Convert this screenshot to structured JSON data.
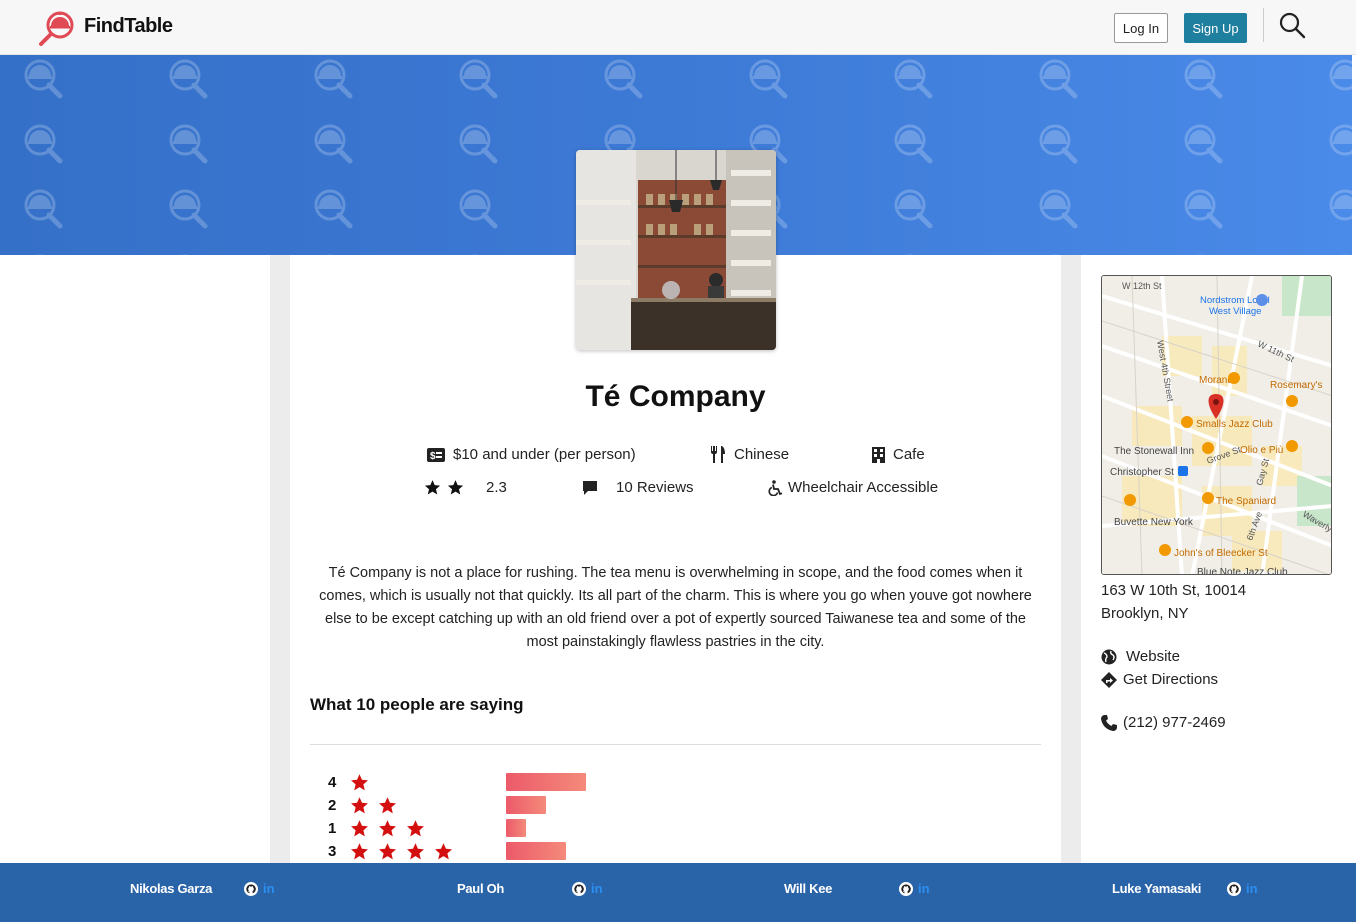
{
  "header": {
    "brand": "FindTable",
    "login_label": "Log In",
    "signup_label": "Sign Up",
    "search_icon": "search-icon"
  },
  "restaurant": {
    "name": "Té Company",
    "price": "$10 and under (per person)",
    "cuisine": "Chinese",
    "category": "Cafe",
    "rating": 2.3,
    "rating_stars_shown": 2,
    "rating_label": "2.3",
    "reviews_label": "10 Reviews",
    "accessibility": "Wheelchair Accessible",
    "description": "Té Company is not a place for rushing. The tea menu is overwhelming in scope, and the food comes when it comes, which is usually not that quickly. Its all part of the charm. This is where you go when youve got nowhere else to be except catching up with an old friend over a pot of expertly sourced Taiwanese tea and some of the most painstakingly flawless pastries in the city."
  },
  "reviews": {
    "heading": "What 10 people are saying",
    "breakdown": [
      {
        "count_label": "4",
        "stars": 1,
        "share": 0.4
      },
      {
        "count_label": "2",
        "stars": 2,
        "share": 0.2
      },
      {
        "count_label": "1",
        "stars": 3,
        "share": 0.1
      },
      {
        "count_label": "3",
        "stars": 4,
        "share": 0.3
      }
    ]
  },
  "sidebar": {
    "map_labels": {
      "w12": "W 12th St",
      "nordstrom": "Nordstrom Local",
      "westvillage": "West Village",
      "w11": "W 11th St",
      "west4": "West 4th Street",
      "morandi": "Morandi",
      "rosemary": "Rosemary's",
      "smalls": "Smalls Jazz Club",
      "stonewall": "The Stonewall Inn",
      "olio": "Olio e Più",
      "christopher": "Christopher St",
      "grove": "Grove St",
      "gay": "Gay St",
      "spaniard": "The Spaniard",
      "buvette": "Buvette New York",
      "sixth": "6th Ave",
      "waverly": "Waverly Pl",
      "johns": "John's of Bleecker St",
      "bluenote": "Blue Note Jazz Club"
    },
    "address_line1": "163 W 10th St, 10014",
    "address_line2": "Brooklyn, NY",
    "website_label": "Website",
    "directions_label": "Get Directions",
    "phone": "(212) 977-2469"
  },
  "footer": {
    "developers": [
      {
        "name": "Nikolas Garza"
      },
      {
        "name": "Paul Oh"
      },
      {
        "name": "Will Kee"
      },
      {
        "name": "Luke Yamasaki"
      }
    ],
    "linkedin_label": "in"
  },
  "colors": {
    "star": "#d40f0f",
    "bar": "#ec5a6a",
    "signup": "#1f7f9e",
    "hero": "#3d7ad6",
    "footer": "#2a64a8"
  }
}
